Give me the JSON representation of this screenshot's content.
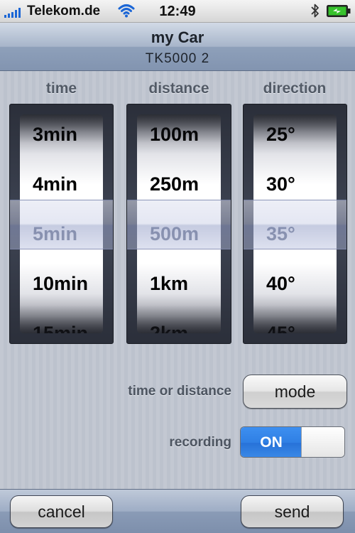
{
  "status_bar": {
    "carrier": "Telekom.de",
    "time": "12:49",
    "signal_icon": "signal-bars-icon",
    "wifi_icon": "wifi-icon",
    "bluetooth_icon": "bluetooth-icon",
    "battery_icon": "battery-charging-icon"
  },
  "header": {
    "title": "my Car",
    "subtitle": "TK5000 2"
  },
  "pickers": {
    "time": {
      "label": "time",
      "items": [
        "3min",
        "4min",
        "5min",
        "10min",
        "15min"
      ],
      "selected": "5min"
    },
    "distance": {
      "label": "distance",
      "items": [
        "100m",
        "250m",
        "500m",
        "1km",
        "2km"
      ],
      "selected": "500m"
    },
    "direction": {
      "label": "direction",
      "items": [
        "25°",
        "30°",
        "35°",
        "40°",
        "45°"
      ],
      "selected": "35°"
    }
  },
  "settings": {
    "mode_label": "time or distance",
    "mode_button": "mode",
    "recording_label": "recording",
    "recording_state": "ON"
  },
  "toolbar": {
    "cancel_label": "cancel",
    "send_label": "send"
  },
  "colors": {
    "accent_blue": "#2f7fe4",
    "header_text": "#1d232b",
    "label_gray": "#4d5561"
  }
}
